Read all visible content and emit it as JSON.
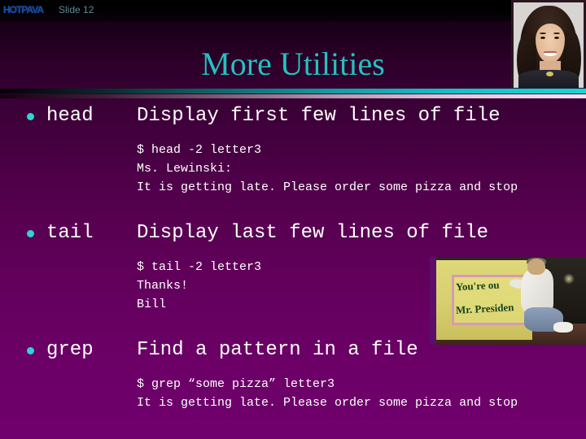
{
  "header": {
    "logo_text": "HOTPAVA",
    "slide_label": "Slide 12"
  },
  "title": "More Utilities",
  "colors": {
    "title": "#28bfc4",
    "bullet": "#2fd4d4",
    "text": "#ffffff",
    "background_top": "#090008",
    "background_bottom": "#70006d",
    "rule_teal": "#1cd3d8",
    "rule_pink": "#f3e6f3"
  },
  "blocks": [
    {
      "command": "head",
      "description": "Display first few lines of file",
      "example": "$ head -2 letter3\nMs. Lewinski:\nIt is getting late. Please order some pizza and stop"
    },
    {
      "command": "tail",
      "description": "Display last few lines of file",
      "example": "$ tail -2 letter3\nThanks!\nBill"
    },
    {
      "command": "grep",
      "description": "Find a pattern in a file",
      "example": "$ grep “some pizza” letter3\nIt is getting late. Please order some pizza and stop"
    }
  ],
  "images": {
    "portrait_alt": "portrait-photo-woman",
    "banner_alt": "banner-photo-protester",
    "banner_line1": "You're ou",
    "banner_line2": "Mr. Presiden"
  }
}
